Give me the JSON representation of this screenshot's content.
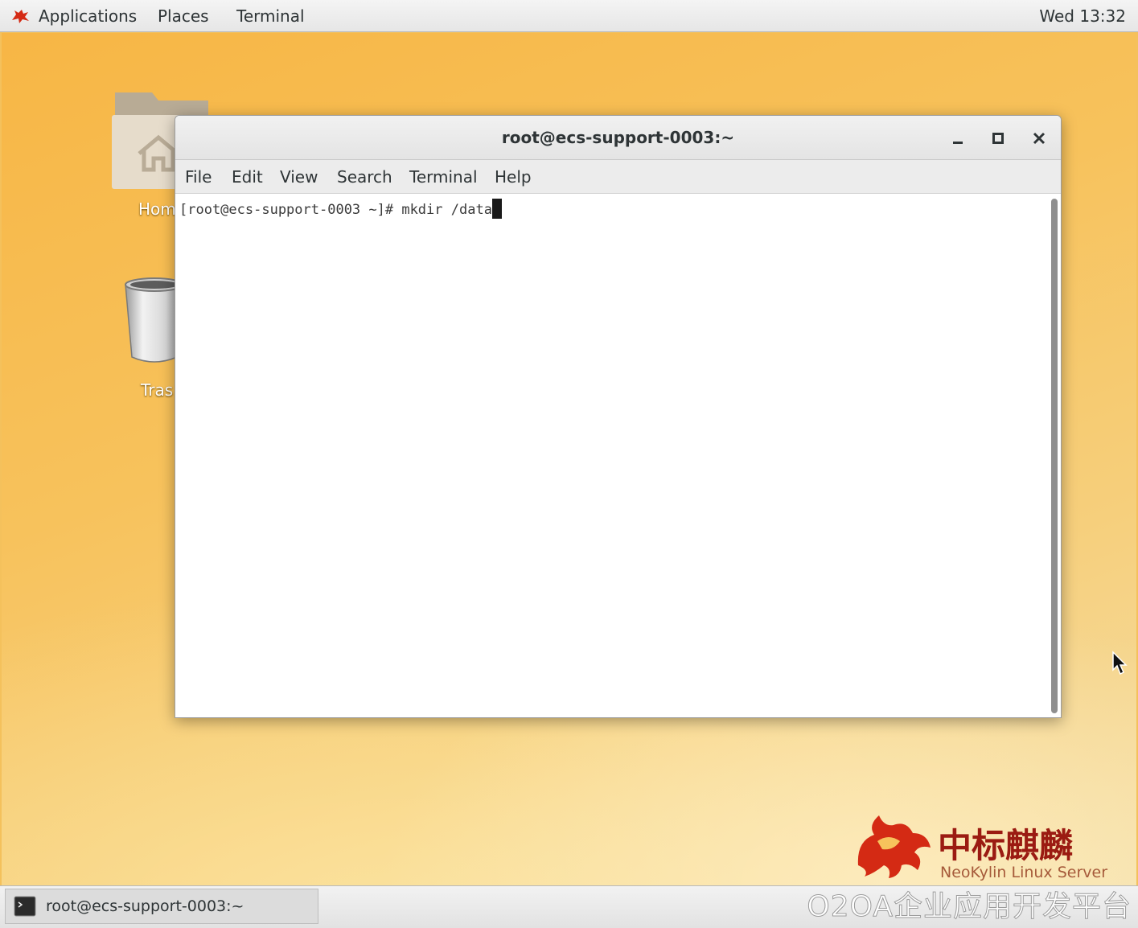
{
  "top_panel": {
    "applications": "Applications",
    "places": "Places",
    "terminal": "Terminal",
    "clock": "Wed 13:32"
  },
  "desktop": {
    "icons": [
      {
        "label": "Hom",
        "icon": "home-folder-icon"
      },
      {
        "label": "Tras",
        "icon": "trash-icon"
      }
    ],
    "brand_cn": "中标麒麟",
    "brand_en": "NeoKylin Linux Server"
  },
  "window": {
    "title": "root@ecs-support-0003:~",
    "menu": [
      "File",
      "Edit",
      "View",
      "Search",
      "Terminal",
      "Help"
    ],
    "terminal_text": "[root@ecs-support-0003 ~]# mkdir /data"
  },
  "taskbar": {
    "task_label": "root@ecs-support-0003:~",
    "watermark": "O2OA企业应用开发平台"
  },
  "colors": {
    "brand_red": "#d42a14",
    "desktop_orange": "#f7b645"
  }
}
